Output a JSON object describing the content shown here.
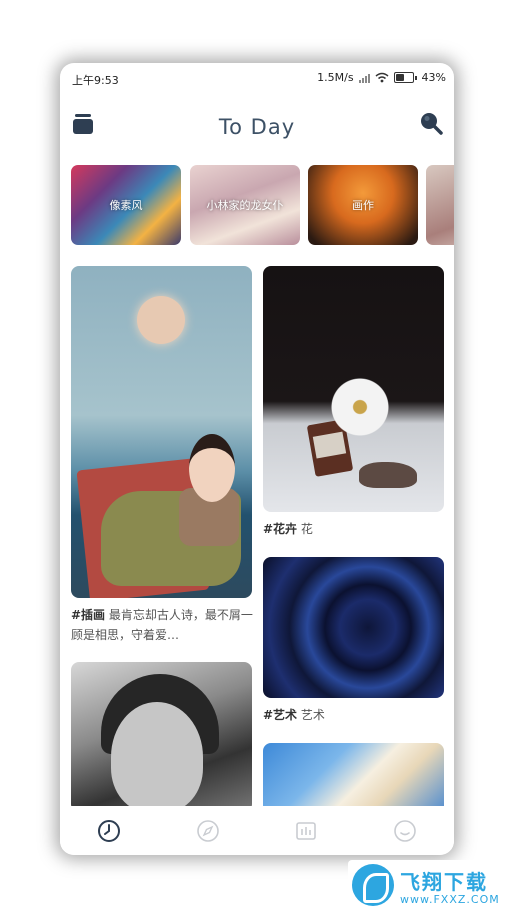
{
  "status": {
    "time": "上午9:53",
    "speed": "1.5M/s",
    "battery": "43%"
  },
  "header": {
    "title": "To Day",
    "menu_icon": "layers-icon",
    "search_icon": "search-icon"
  },
  "categories": [
    {
      "label": "像素风"
    },
    {
      "label": "小林家的龙女仆"
    },
    {
      "label": "画作"
    },
    {
      "label": ""
    }
  ],
  "feed": {
    "card1": {
      "tag": "#插画",
      "text": "最肯忘却古人诗，最不屑一顾是相思，守着爱…"
    },
    "card2": {
      "tag": "#花卉",
      "text": "花"
    },
    "card3": {
      "tag": "#艺术",
      "text": "艺术"
    }
  },
  "bottom_nav": [
    {
      "icon": "clock-icon",
      "active": true
    },
    {
      "icon": "compass-icon",
      "active": false
    },
    {
      "icon": "chart-icon",
      "active": false
    },
    {
      "icon": "smile-icon",
      "active": false
    }
  ],
  "watermark": {
    "title": "飞翔下载",
    "url": "www.FXXZ.COM"
  },
  "colors": {
    "title": "#3d5166",
    "active_icon": "#2e3e52",
    "inactive_icon": "#c9ccd1"
  }
}
